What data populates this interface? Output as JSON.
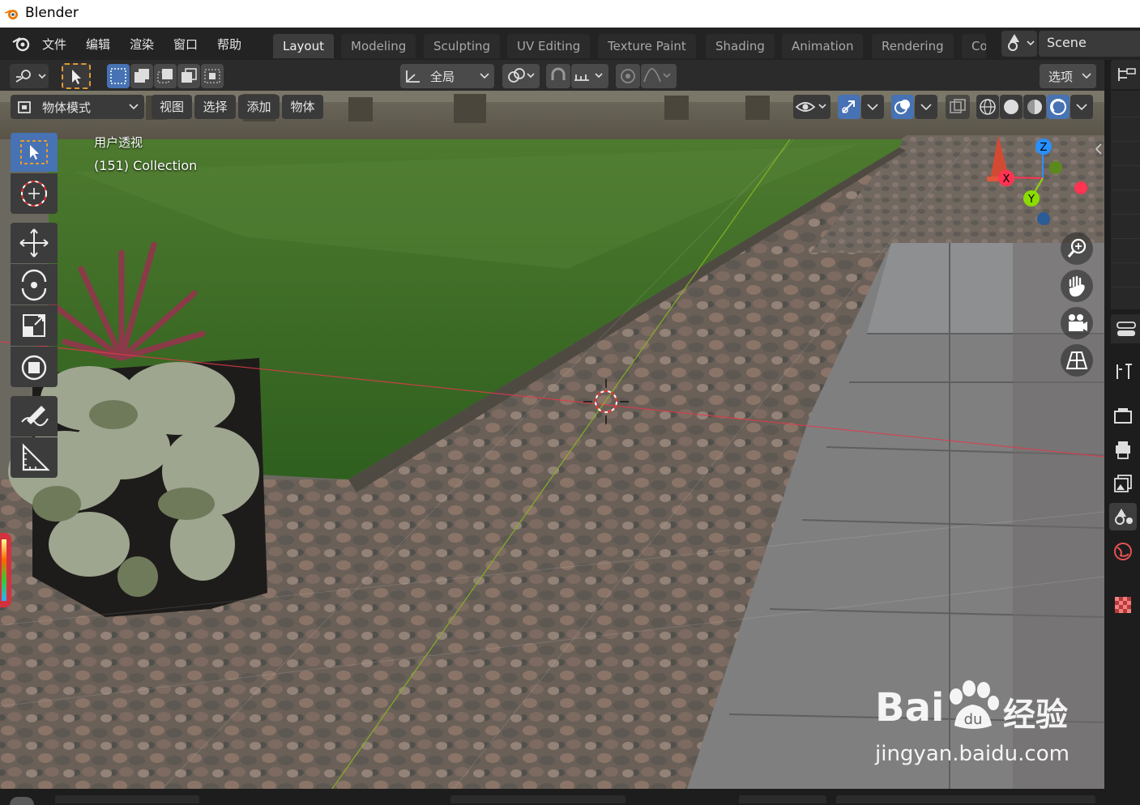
{
  "window": {
    "title": "Blender"
  },
  "menu": [
    "文件",
    "编辑",
    "渲染",
    "窗口",
    "帮助"
  ],
  "workspace_tabs": [
    "Layout",
    "Modeling",
    "Sculpting",
    "UV Editing",
    "Texture Paint",
    "Shading",
    "Animation",
    "Rendering",
    "Co"
  ],
  "active_workspace": "Layout",
  "scene": {
    "name": "Scene"
  },
  "header": {
    "transform_orientation": "全局",
    "options_label": "选项"
  },
  "viewport_header": {
    "mode": "物体模式",
    "menus": [
      "视图",
      "选择",
      "添加",
      "物体"
    ]
  },
  "viewport": {
    "view_name": "用户透视",
    "collection_info": "(151) Collection"
  },
  "gizmo": {
    "z": "Z",
    "x": "X",
    "y": "Y"
  },
  "watermark": {
    "brand": "Bai",
    "cn": "经验",
    "url": "jingyan.baidu.com"
  },
  "colors": {
    "accent": "#4772b3",
    "x_axis": "#ff3352",
    "y_axis": "#8bdc00",
    "z_axis": "#2890ff"
  }
}
